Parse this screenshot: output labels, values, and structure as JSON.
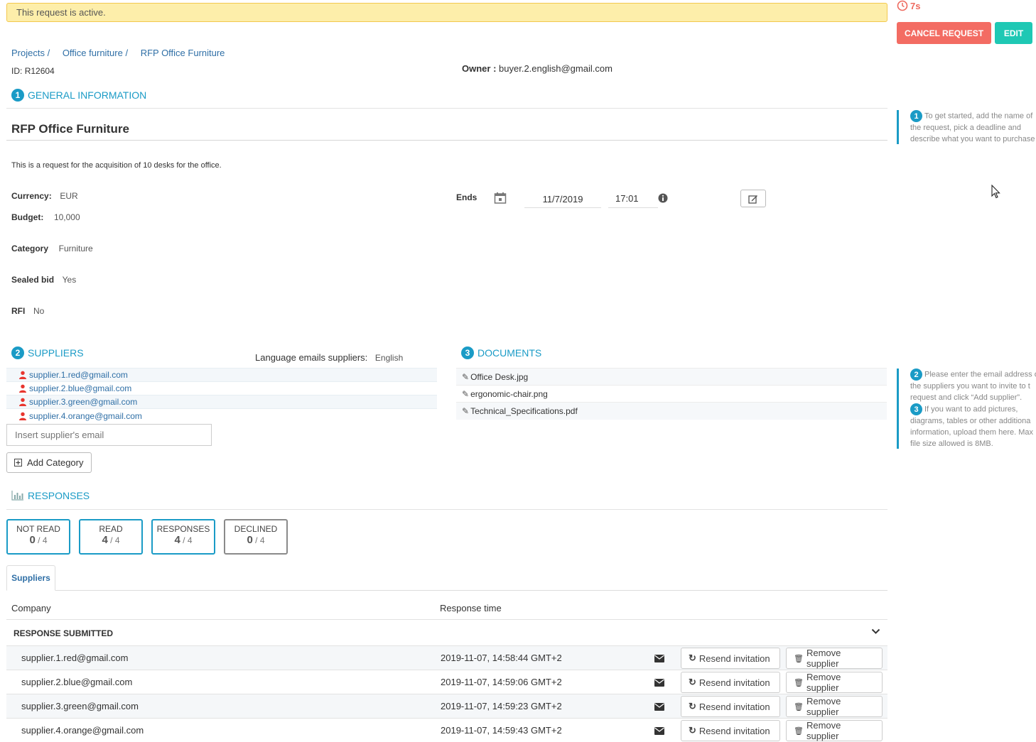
{
  "banner": {
    "text": "This request is active."
  },
  "timer": {
    "text": "7s"
  },
  "actions": {
    "cancel_label": "CANCEL REQUEST",
    "edit_label": "EDIT"
  },
  "breadcrumb": [
    {
      "label": "Projects /"
    },
    {
      "label": "Office furniture /"
    },
    {
      "label": "RFP Office Furniture"
    }
  ],
  "meta": {
    "id_label": "ID:",
    "id_value": "R12604",
    "owner_label": "Owner :",
    "owner_value": "buyer.2.english@gmail.com"
  },
  "general": {
    "num": "1",
    "heading": "GENERAL INFORMATION",
    "title": "RFP Office Furniture",
    "description": "This is a request for the acquisition of 10 desks for the office.",
    "currency_label": "Currency:",
    "currency_value": "EUR",
    "budget_label": "Budget:",
    "budget_value": "10,000",
    "category_label": "Category",
    "category_value": "Furniture",
    "sealed_label": "Sealed bid",
    "sealed_value": "Yes",
    "rfi_label": "RFI",
    "rfi_value": "No",
    "ends_label": "Ends",
    "ends_date": "11/7/2019",
    "ends_time": "17:01"
  },
  "tips": {
    "tip1_num": "1",
    "tip1_lines": [
      "To get started, add the name of",
      "the request, pick a deadline and",
      "describe what you want to purchase"
    ],
    "tip2_num": "2",
    "tip2_lines": [
      "Please enter the email address of",
      "the suppliers you want to invite to t",
      "request and click “Add supplier”."
    ],
    "tip3_num": "3",
    "tip3_lines": [
      "If you want to add pictures,",
      "diagrams, tables or other additiona",
      "information, upload them here. Max",
      "file size allowed is 8MB."
    ]
  },
  "suppliers": {
    "num": "2",
    "heading": "SUPPLIERS",
    "lang_label": "Language emails suppliers:",
    "lang_value": "English",
    "list": [
      "supplier.1.red@gmail.com",
      "supplier.2.blue@gmail.com",
      "supplier.3.green@gmail.com",
      "supplier.4.orange@gmail.com"
    ],
    "input_placeholder": "Insert supplier's email",
    "add_category_label": "Add Category"
  },
  "documents": {
    "num": "3",
    "heading": "DOCUMENTS",
    "files": [
      "Office Desk.jpg",
      "ergonomic-chair.png",
      "Technical_Specifications.pdf"
    ]
  },
  "responses": {
    "heading": "RESPONSES",
    "stats": [
      {
        "label": "NOT READ",
        "value": "0",
        "total": " / 4"
      },
      {
        "label": "READ",
        "value": "4",
        "total": " / 4"
      },
      {
        "label": "RESPONSES",
        "value": "4",
        "total": " / 4"
      },
      {
        "label": "DECLINED",
        "value": "0",
        "total": " / 4"
      }
    ],
    "tab_label": "Suppliers",
    "col_company": "Company",
    "col_time": "Response time",
    "group_label": "RESPONSE SUBMITTED",
    "resend_label": "Resend invitation",
    "remove_label": "Remove supplier",
    "rows": [
      {
        "company": "supplier.1.red@gmail.com",
        "time": "2019-11-07, 14:58:44 GMT+2"
      },
      {
        "company": "supplier.2.blue@gmail.com",
        "time": "2019-11-07, 14:59:06 GMT+2"
      },
      {
        "company": "supplier.3.green@gmail.com",
        "time": "2019-11-07, 14:59:23 GMT+2"
      },
      {
        "company": "supplier.4.orange@gmail.com",
        "time": "2019-11-07, 14:59:43 GMT+2"
      }
    ]
  }
}
